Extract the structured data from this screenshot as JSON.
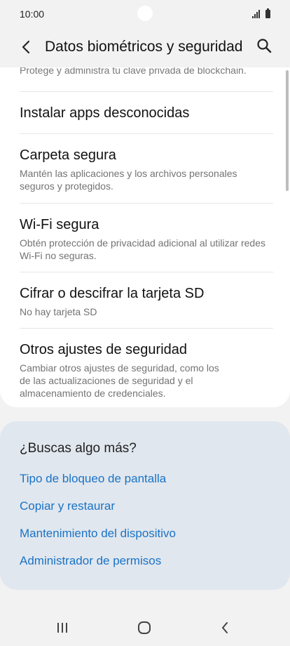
{
  "status_bar": {
    "time": "10:00"
  },
  "header": {
    "title": "Datos biométricos y seguridad",
    "back_icon": "chevron-left-icon",
    "search_icon": "search-icon"
  },
  "card": {
    "cut_off_text": "Protege y administra tu clave privada de blockchain.",
    "items": [
      {
        "title": "Instalar apps desconocidas",
        "subtitle": ""
      },
      {
        "title": "Carpeta segura",
        "subtitle": "Mantén las aplicaciones y los archivos personales seguros y protegidos."
      },
      {
        "title": "Wi-Fi segura",
        "subtitle": "Obtén protección de privacidad adicional al utilizar redes Wi-Fi no seguras."
      },
      {
        "title": "Cifrar o descifrar la tarjeta SD",
        "subtitle": "No hay tarjeta SD"
      },
      {
        "title": "Otros ajustes de seguridad",
        "subtitle": "Cambiar otros ajustes de seguridad, como los de las actualizaciones de seguridad y el almacenamiento de credenciales."
      }
    ]
  },
  "suggestions": {
    "title": "¿Buscas algo más?",
    "links": [
      "Tipo de bloqueo de pantalla",
      "Copiar y restaurar",
      "Mantenimiento del dispositivo",
      "Administrador de permisos"
    ]
  },
  "colors": {
    "link": "#1a73c6",
    "suggest_bg": "#e1e7ee",
    "page_bg": "#f2f2f2"
  }
}
